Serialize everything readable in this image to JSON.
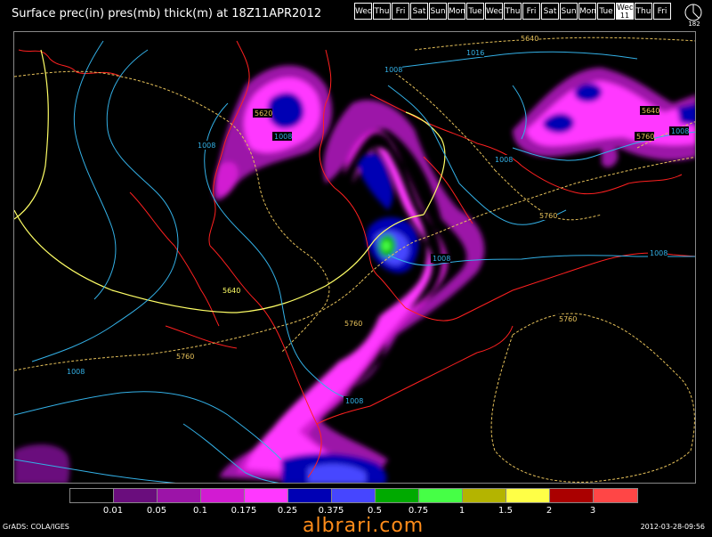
{
  "header": {
    "title": "Surface prec(in) pres(mb) thick(m) at 18Z11APR2012",
    "days": [
      "Wed",
      "Thu",
      "Fri",
      "Sat",
      "Sun",
      "Mon",
      "Tue",
      "Wed",
      "Thu",
      "Fri",
      "Sat",
      "Sun",
      "Mon",
      "Tue",
      "Wed",
      "Thu",
      "Fri"
    ],
    "active_day_index": 14,
    "active_day_sub": "11",
    "logo_label": "182"
  },
  "contour_labels": {
    "thickness": [
      "5640",
      "5620",
      "5760",
      "5640",
      "5760",
      "5640",
      "5760",
      "5760",
      "5760"
    ],
    "pressure": [
      "1016",
      "1008",
      "1008",
      "1008",
      "1008",
      "1008",
      "1008",
      "1008",
      "1008",
      "1008"
    ]
  },
  "legend": {
    "labels": [
      "0.01",
      "0.05",
      "0.1",
      "0.175",
      "0.25",
      "0.375",
      "0.5",
      "0.75",
      "1",
      "1.5",
      "2",
      "3"
    ],
    "colors": [
      "#000000",
      "#6a0d7d",
      "#9c14a8",
      "#d21bd2",
      "#ff38ff",
      "#0000b4",
      "#4646ff",
      "#00aa00",
      "#46ff46",
      "#b4b400",
      "#ffff46",
      "#aa0000",
      "#ff4646"
    ]
  },
  "footer": {
    "left": "GrADS: COLA/IGES",
    "right": "2012-03-28-09:56",
    "watermark": "albrari.com"
  }
}
